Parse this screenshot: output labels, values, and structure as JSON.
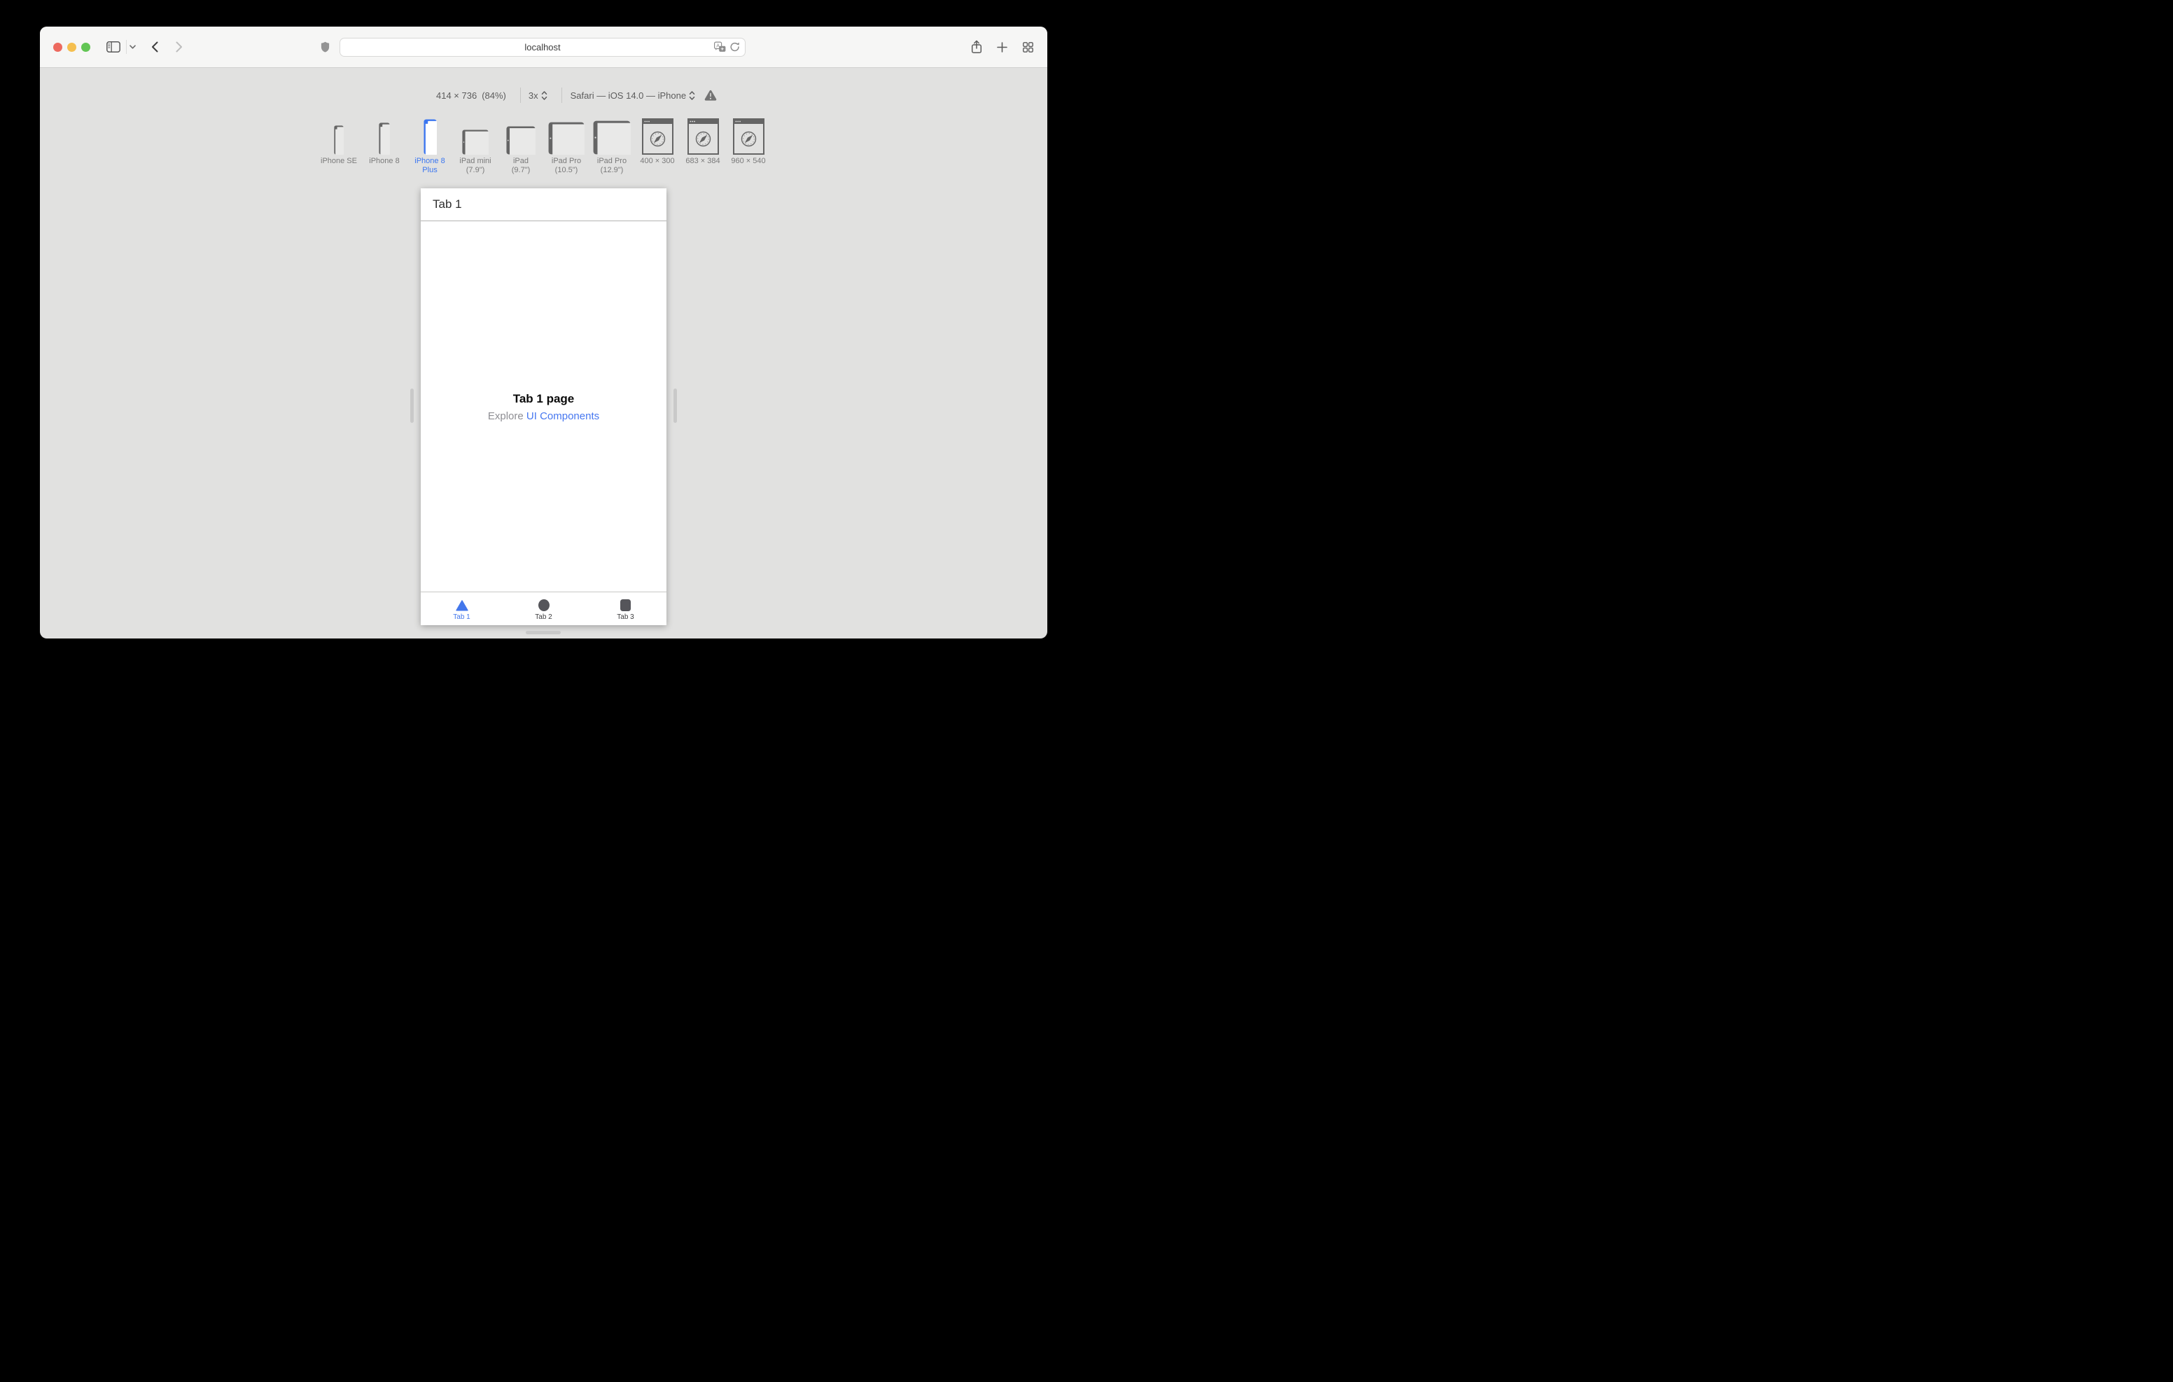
{
  "toolbar": {
    "url": "localhost",
    "icons": {
      "left": [
        "sidebar-toggle-icon",
        "chevron-down-icon",
        "back-icon",
        "forward-icon"
      ],
      "address": [
        "privacy-shield-icon",
        "translate-icon",
        "reload-icon"
      ],
      "right": [
        "share-icon",
        "new-tab-icon",
        "tab-overview-icon"
      ]
    }
  },
  "rdm": {
    "dimensions": "414 × 736",
    "zoom_percent": "(84%)",
    "pixel_ratio": "3x",
    "user_agent": "Safari — iOS 14.0 — iPhone",
    "warning_icon": "warning-icon",
    "devices": [
      {
        "line1": "iPhone SE",
        "type": "phone",
        "selected": false
      },
      {
        "line1": "iPhone 8",
        "type": "phone",
        "selected": false
      },
      {
        "line1": "iPhone 8",
        "line2": "Plus",
        "type": "phone",
        "selected": true
      },
      {
        "line1": "iPad mini",
        "line2": "(7.9\")",
        "type": "tablet",
        "selected": false
      },
      {
        "line1": "iPad",
        "line2": "(9.7\")",
        "type": "tablet",
        "selected": false
      },
      {
        "line1": "iPad Pro",
        "line2": "(10.5\")",
        "type": "tablet",
        "selected": false
      },
      {
        "line1": "iPad Pro",
        "line2": "(12.9\")",
        "type": "tablet",
        "selected": false
      },
      {
        "line1": "400 × 300",
        "type": "browser",
        "selected": false
      },
      {
        "line1": "683 × 384",
        "type": "browser",
        "selected": false
      },
      {
        "line1": "960 × 540",
        "type": "browser",
        "selected": false
      }
    ]
  },
  "preview": {
    "nav_title": "Tab 1",
    "page_title": "Tab 1 page",
    "subtitle_prefix": "Explore",
    "subtitle_link": "UI Components",
    "tabs": [
      {
        "label": "Tab 1",
        "icon": "triangle",
        "active": true
      },
      {
        "label": "Tab 2",
        "icon": "circle",
        "active": false
      },
      {
        "label": "Tab 3",
        "icon": "square",
        "active": false
      }
    ]
  },
  "colors": {
    "accent_blue": "#3b76f0",
    "link_blue": "#4677f0",
    "tab_active_blue": "#4377eb",
    "device_gray": "#656565",
    "toolbar_bg": "#f6f6f5",
    "content_bg": "#e1e1e0"
  }
}
